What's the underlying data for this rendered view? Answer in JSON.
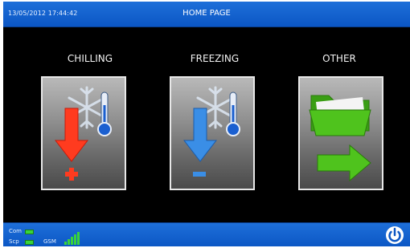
{
  "header": {
    "datetime": "13/05/2012 17:44:42",
    "title": "HOME PAGE"
  },
  "menu": [
    {
      "label": "CHILLING",
      "icon": "chilling-icon"
    },
    {
      "label": "FREEZING",
      "icon": "freezing-icon"
    },
    {
      "label": "OTHER",
      "icon": "folder-arrow-icon"
    }
  ],
  "status": {
    "com_label": "Com",
    "scp_label": "Scp",
    "gsm_label": "GSM",
    "gsm_signal_bars": 5
  },
  "colors": {
    "bar_blue": "#0b56c4",
    "led_green": "#39d43a",
    "chill_red": "#ff3b1f",
    "freeze_blue": "#3a8ee6",
    "folder_green": "#4fc31d"
  }
}
